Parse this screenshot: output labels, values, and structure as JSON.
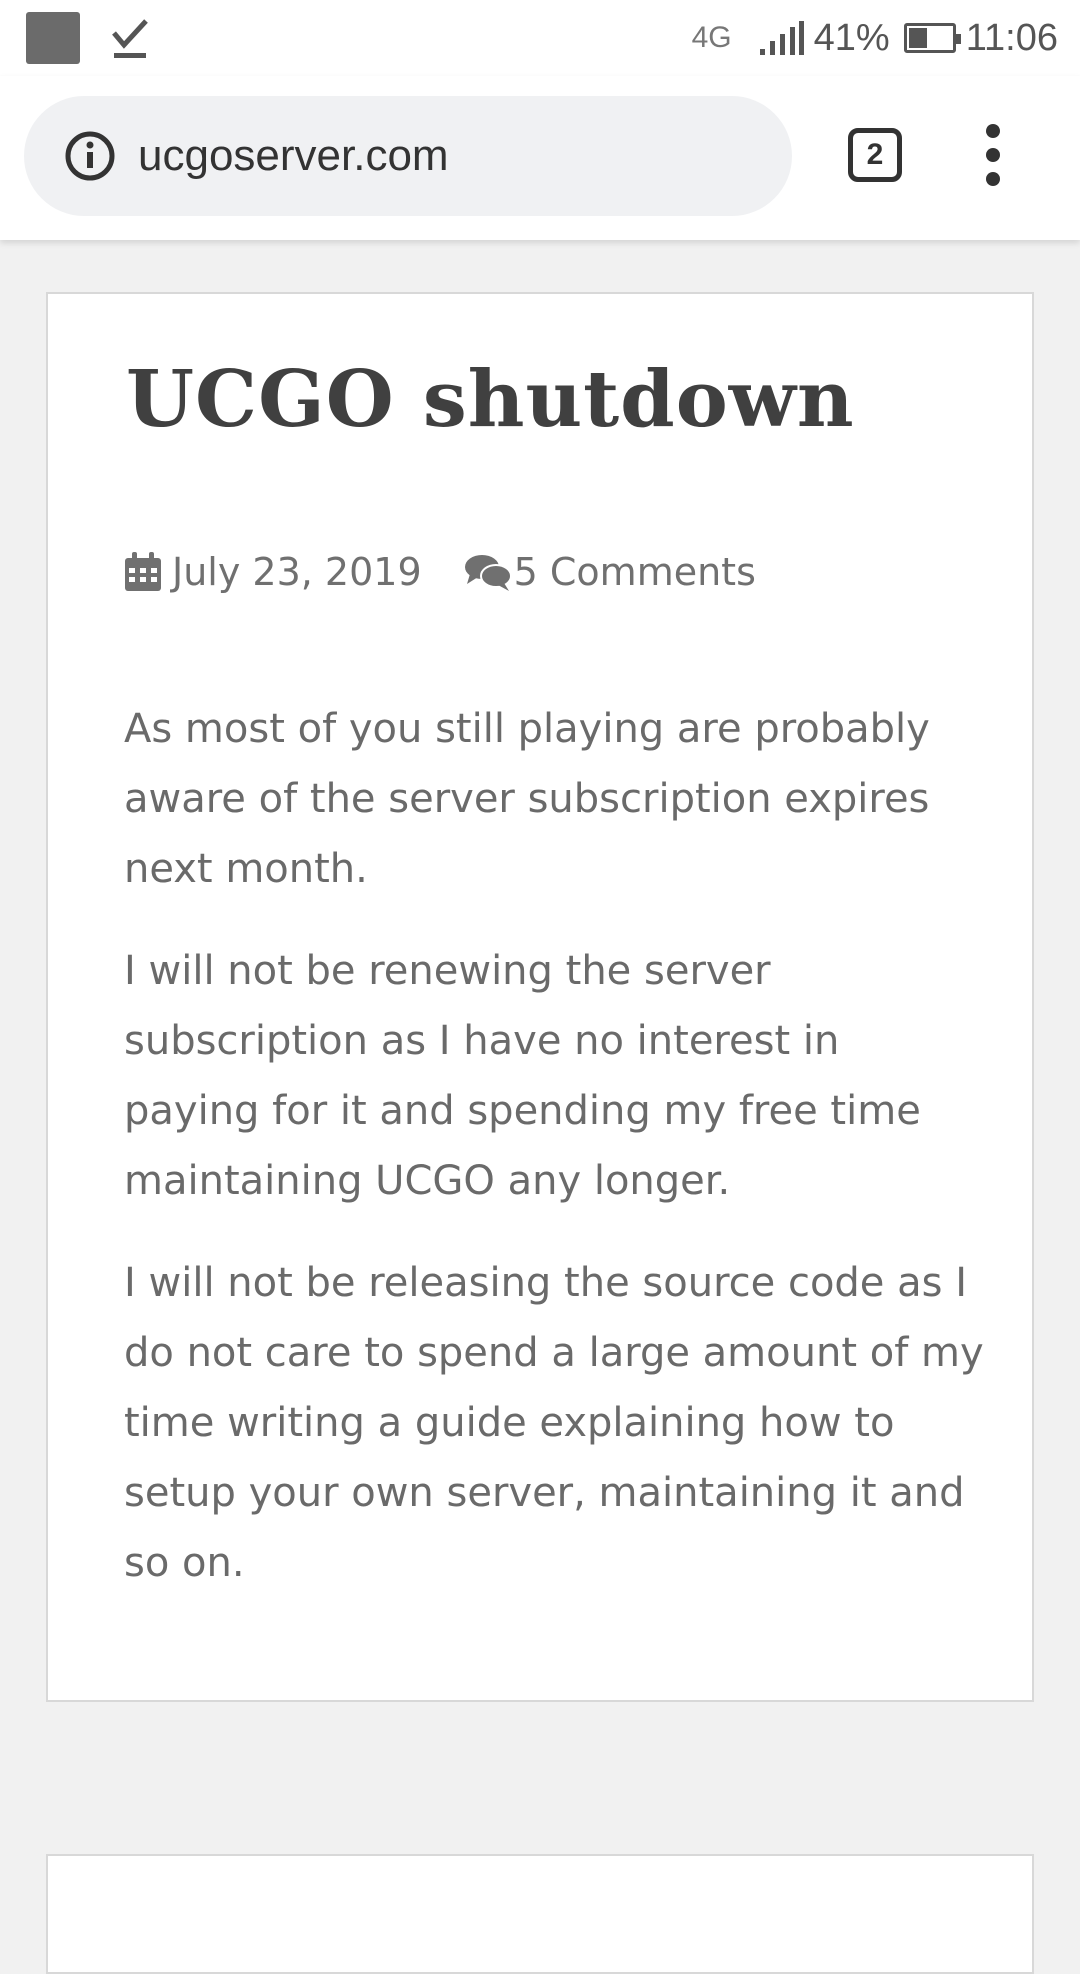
{
  "status_bar": {
    "network": "4G",
    "battery": "41%",
    "battery_level": 0.41,
    "time": "11:06"
  },
  "browser": {
    "url": "ucgoserver.com",
    "tab_count": "2"
  },
  "post": {
    "title": "UCGO shutdown",
    "date": "July 23, 2019",
    "comments": "5 Comments",
    "paragraphs": [
      "As most of you still playing are probably aware of the server subscription expires next month.",
      "I will not be renewing the server subscription as I have no interest in paying for it and spending my free time maintaining UCGO any longer.",
      "I will not be releasing the source code as I do not care to spend a large amount of my time writing a guide explaining how to setup your own server, maintaining it and so on."
    ]
  },
  "icons": {
    "status_left": [
      "notification-square-icon",
      "download-done-icon"
    ],
    "omnibox": "info-icon",
    "meta": [
      "calendar-icon",
      "comments-icon"
    ]
  }
}
